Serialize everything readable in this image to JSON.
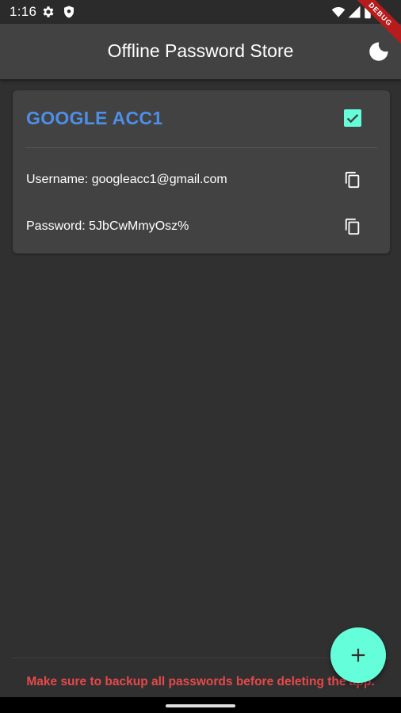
{
  "status_bar": {
    "time": "1:16",
    "debug_label": "DEBUG"
  },
  "app_bar": {
    "title": "Offline Password Store",
    "theme_icon": "moon-icon"
  },
  "entries": [
    {
      "title": "GOOGLE ACC1",
      "checked": true,
      "username_text": "Username: googleacc1@gmail.com",
      "password_text": "Password: 5JbCwMmyOsz%"
    }
  ],
  "footer": {
    "warning": "Make sure to backup all passwords before deleting the app."
  },
  "colors": {
    "background": "#303030",
    "app_bar": "#424242",
    "card": "#424242",
    "title_blue": "#4d8fe8",
    "accent_teal": "#64ffda",
    "warning_red": "#e8484a"
  },
  "icons": {
    "settings": "gear-icon",
    "shield": "shield-icon",
    "wifi": "wifi-icon",
    "signal": "signal-icon",
    "battery": "battery-icon",
    "copy": "copy-icon",
    "add": "plus-icon"
  }
}
